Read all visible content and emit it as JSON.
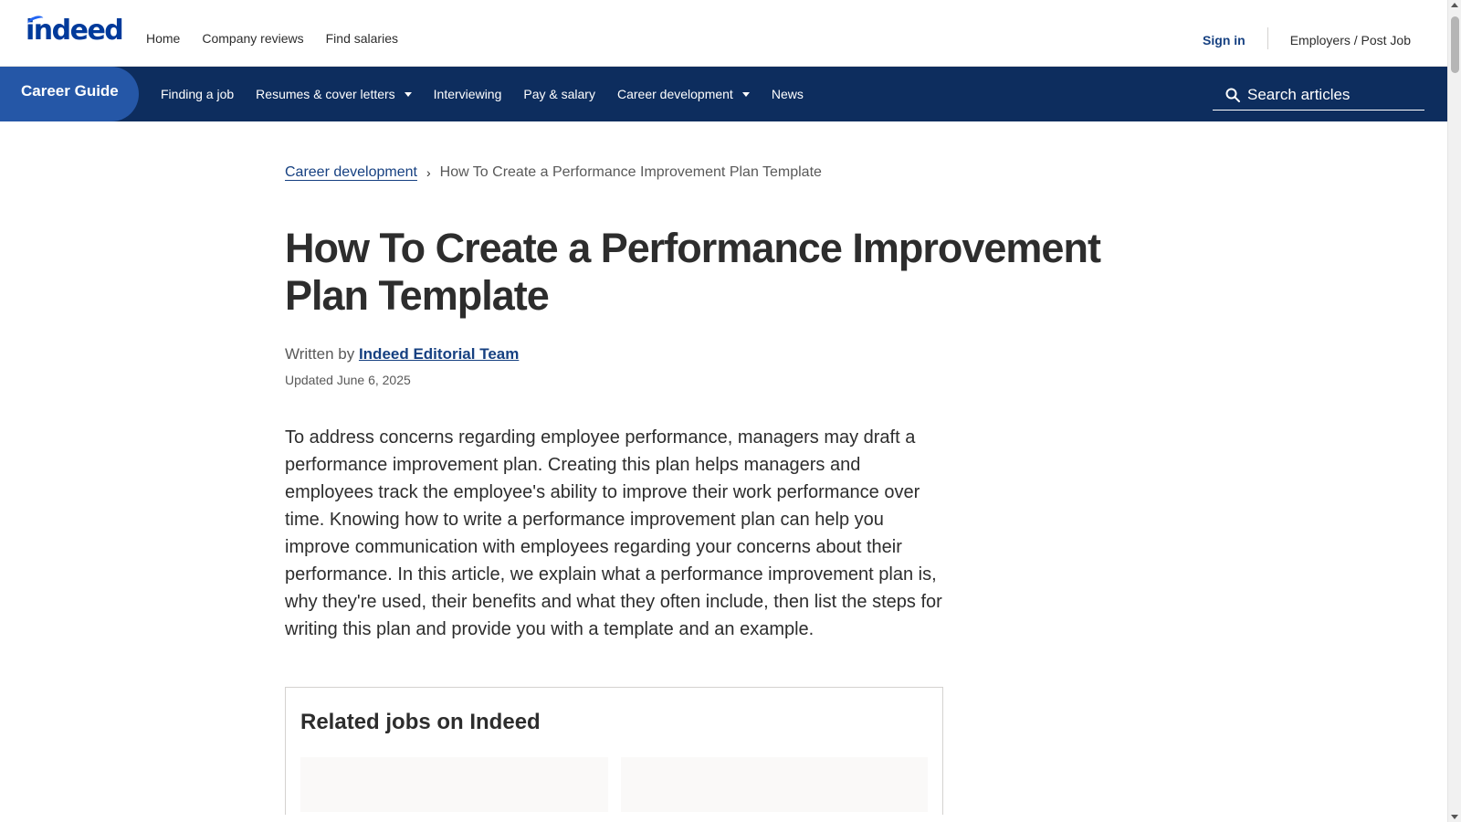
{
  "header": {
    "logo": "indeed",
    "nav": [
      "Home",
      "Company reviews",
      "Find salaries"
    ],
    "sign_in": "Sign in",
    "employers": "Employers / Post Job"
  },
  "career_nav": {
    "tab_label": "Career Guide",
    "items": [
      {
        "label": "Finding a job",
        "dropdown": false
      },
      {
        "label": "Resumes & cover letters",
        "dropdown": true
      },
      {
        "label": "Interviewing",
        "dropdown": false
      },
      {
        "label": "Pay & salary",
        "dropdown": false
      },
      {
        "label": "Career development",
        "dropdown": true
      },
      {
        "label": "News",
        "dropdown": false
      }
    ],
    "search_placeholder": "Search articles"
  },
  "article": {
    "breadcrumb": {
      "parent": "Career development",
      "current": "How To Create a Performance Improvement Plan Template"
    },
    "title": "How To Create a Performance Improvement Plan Template",
    "written_by_prefix": "Written by",
    "author": "Indeed Editorial Team",
    "updated": "Updated June 6, 2025",
    "intro": "To address concerns regarding employee performance, managers may draft a performance improvement plan. Creating this plan helps managers and employees track the employee's ability to improve their work performance over time. Knowing how to write a performance improvement plan can help you improve communication with employees regarding your concerns about their performance. In this article, we explain what a performance improvement plan is, why they're used, their benefits and what they often include, then list the steps for writing this plan and provide you with a template and an example."
  },
  "related": {
    "heading": "Related jobs on Indeed"
  },
  "colors": {
    "nav_bg": "#0d2d5e",
    "tab_bg": "#2557a7",
    "link": "#164081",
    "logo": "#003a9b"
  }
}
